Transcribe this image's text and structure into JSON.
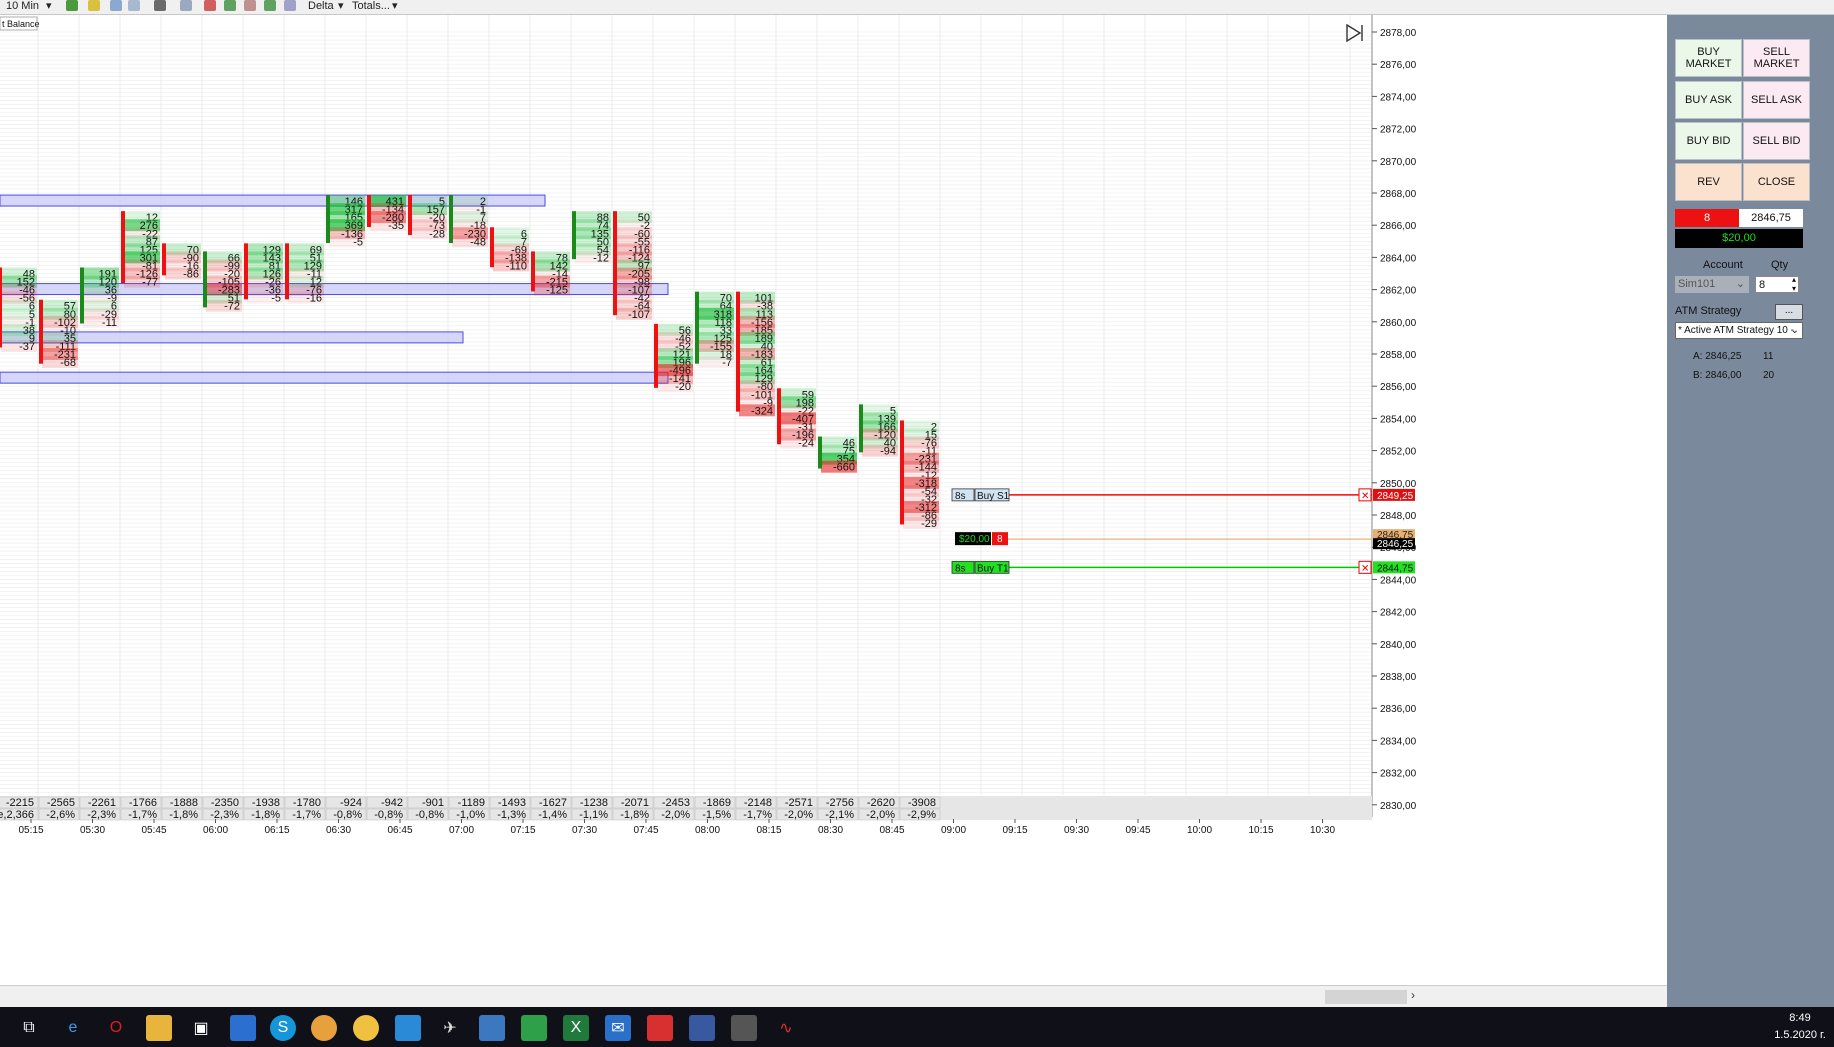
{
  "toolbar": {
    "interval": "10 Min",
    "mode": "Delta",
    "display": "Totals..."
  },
  "chart": {
    "indicator_label": "t Balance",
    "price_labels": [
      "2878,00",
      "2876,00",
      "2874,00",
      "2872,00",
      "2870,00",
      "2868,00",
      "2866,00",
      "2864,00",
      "2862,00",
      "2860,00",
      "2858,00",
      "2856,00",
      "2854,00",
      "2852,00",
      "2850,00",
      "2848,00",
      "2846,00",
      "2844,00",
      "2842,00",
      "2840,00",
      "2838,00",
      "2836,00",
      "2834,00",
      "2832,00",
      "2830,00"
    ],
    "time_labels": [
      "05:15",
      "05:30",
      "05:45",
      "06:00",
      "06:15",
      "06:30",
      "06:45",
      "07:00",
      "07:15",
      "07:30",
      "07:45",
      "08:00",
      "08:15",
      "08:30",
      "08:45",
      "09:00",
      "09:15",
      "09:30",
      "09:45",
      "10:00",
      "10:15",
      "10:30"
    ],
    "totals_row1": [
      "-2215",
      "-2565",
      "-2261",
      "-1766",
      "-1888",
      "-2350",
      "-1938",
      "-1780",
      "-924",
      "-942",
      "-901",
      "-1189",
      "-1493",
      "-1627",
      "-1238",
      "-2071",
      "-2453",
      "-1869",
      "-2148",
      "-2571",
      "-2756",
      "-2620",
      "-3908"
    ],
    "totals_row2": [
      "de,2,366",
      "-2,6%",
      "-2,3%",
      "-1,7%",
      "-1,8%",
      "-2,3%",
      "-1,8%",
      "-1,7%",
      "-0,8%",
      "-0,8%",
      "-0,8%",
      "-1,0%",
      "-1,3%",
      "-1,4%",
      "-1,1%",
      "-1,8%",
      "-2,0%",
      "-1,5%",
      "-1,7%",
      "-2,0%",
      "-2,1%",
      "-2,0%",
      "-2,9%"
    ],
    "columns": [
      {
        "top": 2863.0,
        "vals": [
          "48",
          "152",
          "-46",
          "-56",
          "6",
          "5",
          "-1",
          "38",
          "9",
          "-37"
        ]
      },
      {
        "top": 2861.0,
        "vals": [
          "57",
          "80",
          "-102",
          "-10",
          "35",
          "-111",
          "-231",
          "-68"
        ]
      },
      {
        "top": 2863.0,
        "vals": [
          "191",
          "120",
          "36",
          "-9",
          "6",
          "-29",
          "-11"
        ]
      },
      {
        "top": 2866.5,
        "vals": [
          "12",
          "276",
          "-22",
          "87",
          "125",
          "301",
          "-81",
          "-126",
          "-77"
        ]
      },
      {
        "top": 2864.5,
        "vals": [
          "70",
          "-90",
          "-16",
          "-86"
        ]
      },
      {
        "top": 2864.0,
        "vals": [
          "66",
          "-99",
          "-20",
          "-105",
          "-283",
          "51",
          "-72"
        ]
      },
      {
        "top": 2864.5,
        "vals": [
          "129",
          "143",
          "81",
          "126",
          "-26",
          "-36",
          "-5"
        ]
      },
      {
        "top": 2864.5,
        "vals": [
          "69",
          "51",
          "129",
          "-11",
          "12",
          "-76",
          "-16"
        ]
      },
      {
        "top": 2867.5,
        "vals": [
          "146",
          "317",
          "165",
          "369",
          "-136",
          "-5"
        ]
      },
      {
        "top": 2867.5,
        "vals": [
          "431",
          "-134",
          "-280",
          "-35"
        ]
      },
      {
        "top": 2867.5,
        "vals": [
          "5",
          "157",
          "-20",
          "-73",
          "-28"
        ]
      },
      {
        "top": 2867.5,
        "vals": [
          "2",
          "-1",
          "7",
          "-18",
          "-230",
          "-48"
        ]
      },
      {
        "top": 2865.5,
        "vals": [
          "6",
          "7",
          "-69",
          "-138",
          "-110"
        ]
      },
      {
        "top": 2864.0,
        "vals": [
          "78",
          "142",
          "-14",
          "-215",
          "-125"
        ]
      },
      {
        "top": 2866.5,
        "vals": [
          "88",
          "74",
          "135",
          "50",
          "54",
          "-12"
        ]
      },
      {
        "top": 2866.5,
        "vals": [
          "50",
          "-2",
          "-60",
          "-55",
          "-116",
          "-124",
          "97",
          "-205",
          "-98",
          "-107",
          "-42",
          "-64",
          "-107"
        ]
      },
      {
        "top": 2859.5,
        "vals": [
          "56",
          "-46",
          "-52",
          "121",
          "196",
          "-496",
          "-141",
          "-20"
        ]
      },
      {
        "top": 2861.5,
        "vals": [
          "70",
          "64",
          "318",
          "118",
          "33",
          "125",
          "-155",
          "18",
          "-7"
        ]
      },
      {
        "top": 2861.5,
        "vals": [
          "101",
          "-38",
          "113",
          "-156",
          "-185",
          "189",
          "40",
          "-183",
          "61",
          "164",
          "129",
          "-80",
          "-101",
          "-9",
          "-324"
        ]
      },
      {
        "top": 2855.5,
        "vals": [
          "59",
          "198",
          "-22",
          "-407",
          "-31",
          "-196",
          "-24"
        ]
      },
      {
        "top": 2852.5,
        "vals": [
          "46",
          "75",
          "354",
          "-660"
        ]
      },
      {
        "top": 2854.5,
        "vals": [
          "5",
          "139",
          "166",
          "-120",
          "40",
          "-94"
        ]
      },
      {
        "top": 2853.5,
        "vals": [
          "2",
          "15",
          "-76",
          "-11",
          "-231",
          "-144",
          "-12",
          "-318",
          "-54",
          "-32",
          "-312",
          "-86",
          "-29"
        ]
      }
    ],
    "orders": {
      "stop_label": "8s",
      "stop_name": "Buy S1",
      "stop_price": "2849,25",
      "pos_pnl": "$20,00",
      "pos_qty": "8",
      "pos_price_top": "2846,75",
      "pos_price_cur": "2846,25",
      "target_label": "8s",
      "target_name": "Buy T1",
      "target_price": "2844,75"
    }
  },
  "panel": {
    "buy_market": "BUY MARKET",
    "sell_market": "SELL MARKET",
    "buy_ask": "BUY ASK",
    "sell_ask": "SELL ASK",
    "buy_bid": "BUY BID",
    "sell_bid": "SELL BID",
    "rev": "REV",
    "close": "CLOSE",
    "position_qty": "8",
    "position_price": "2846,75",
    "pnl": "$20,00",
    "account_label": "Account",
    "qty_label": "Qty",
    "account_value": "Sim101",
    "qty_value": "8",
    "atm_label": "ATM Strategy",
    "atm_more": "...",
    "atm_value": "* Active ATM Strategy 10 -",
    "ask_line": "A: 2846,25",
    "ask_size": "11",
    "bid_line": "B: 2846,00",
    "bid_size": "20"
  },
  "clock": {
    "time": "8:49",
    "date": "1.5.2020 г."
  },
  "colors": {
    "panel_bg": "#7a8a9c",
    "buy_bg": "#eaf7e9",
    "sell_bg": "#fbeaf1",
    "pos_red": "#ee1111",
    "pnl_green": "#16c316",
    "stop_line": "#ff0000",
    "target_line": "#00c800",
    "pos_line": "#e8b070",
    "highlight": "#c8caf5"
  }
}
